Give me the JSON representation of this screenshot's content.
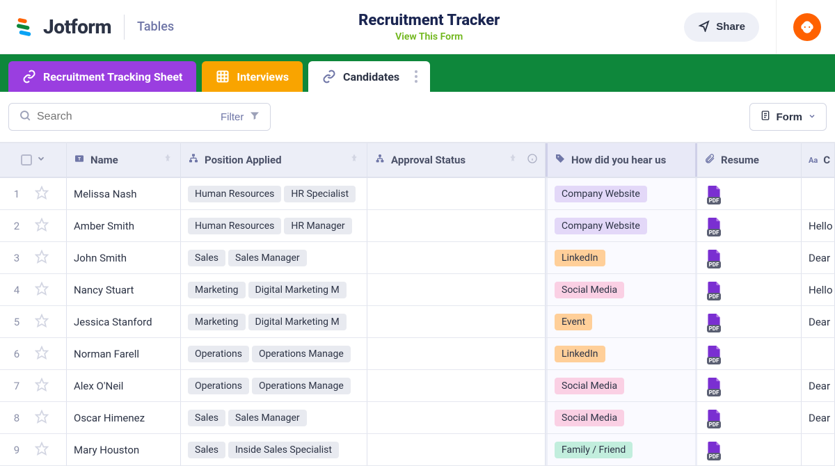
{
  "header": {
    "brand": "Jotform",
    "section": "Tables",
    "title": "Recruitment Tracker",
    "subtitle": "View This Form",
    "share": "Share"
  },
  "tabs": [
    {
      "label": "Recruitment Tracking Sheet"
    },
    {
      "label": "Interviews"
    },
    {
      "label": "Candidates"
    }
  ],
  "toolbar": {
    "search_placeholder": "Search",
    "filter": "Filter",
    "form": "Form"
  },
  "columns": {
    "name": "Name",
    "position": "Position Applied",
    "approval": "Approval Status",
    "hear": "How did you hear us",
    "resume": "Resume",
    "cover": "C"
  },
  "pill_colors": {
    "Company Website": "lav",
    "LinkedIn": "orng",
    "Social Media": "pink",
    "Event": "orng",
    "Family / Friend": "mint"
  },
  "rows": [
    {
      "num": "1",
      "name": "Melissa Nash",
      "position": [
        "Human Resources",
        "HR Specialist"
      ],
      "approval": "",
      "hear": "Company Website",
      "resume": "PDF",
      "cover": ""
    },
    {
      "num": "2",
      "name": "Amber Smith",
      "position": [
        "Human Resources",
        "HR Manager"
      ],
      "approval": "",
      "hear": "Company Website",
      "resume": "PDF",
      "cover": "Hello"
    },
    {
      "num": "3",
      "name": "John Smith",
      "position": [
        "Sales",
        "Sales Manager"
      ],
      "approval": "",
      "hear": "LinkedIn",
      "resume": "PDF",
      "cover": "Dear"
    },
    {
      "num": "4",
      "name": "Nancy Stuart",
      "position": [
        "Marketing",
        "Digital Marketing M"
      ],
      "approval": "",
      "hear": "Social Media",
      "resume": "PDF",
      "cover": "Hello"
    },
    {
      "num": "5",
      "name": "Jessica Stanford",
      "position": [
        "Marketing",
        "Digital Marketing M"
      ],
      "approval": "",
      "hear": "Event",
      "resume": "PDF",
      "cover": "Dear"
    },
    {
      "num": "6",
      "name": "Norman Farell",
      "position": [
        "Operations",
        "Operations Manage"
      ],
      "approval": "",
      "hear": "LinkedIn",
      "resume": "PDF",
      "cover": ""
    },
    {
      "num": "7",
      "name": "Alex O'Neil",
      "position": [
        "Operations",
        "Operations Manage"
      ],
      "approval": "",
      "hear": "Social Media",
      "resume": "PDF",
      "cover": "Dear"
    },
    {
      "num": "8",
      "name": "Oscar Himenez",
      "position": [
        "Sales",
        "Sales Manager"
      ],
      "approval": "",
      "hear": "Social Media",
      "resume": "PDF",
      "cover": "Dear"
    },
    {
      "num": "9",
      "name": "Mary Houston",
      "position": [
        "Sales",
        "Inside Sales Specialist"
      ],
      "approval": "",
      "hear": "Family / Friend",
      "resume": "PDF",
      "cover": ""
    }
  ]
}
